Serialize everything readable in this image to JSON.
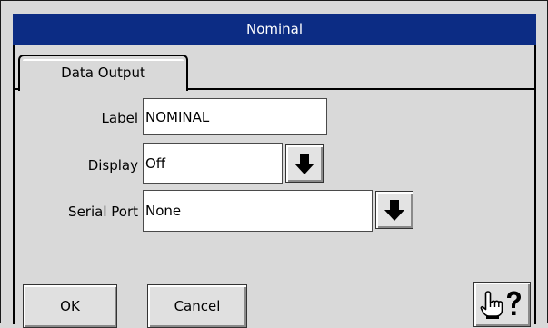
{
  "window": {
    "title": "Nominal"
  },
  "tabs": [
    {
      "label": "Data Output"
    }
  ],
  "form": {
    "label": {
      "label": "Label",
      "value": "NOMINAL"
    },
    "display": {
      "label": "Display",
      "value": "Off"
    },
    "serial_port": {
      "label": "Serial Port",
      "value": "None"
    }
  },
  "buttons": {
    "ok": "OK",
    "cancel": "Cancel"
  },
  "icons": {
    "dropdown": "arrow-down-icon",
    "help": "pointing-hand-question-icon"
  },
  "colors": {
    "titlebar": "#0c2c84",
    "background": "#d9d9d9",
    "field": "#ffffff"
  }
}
